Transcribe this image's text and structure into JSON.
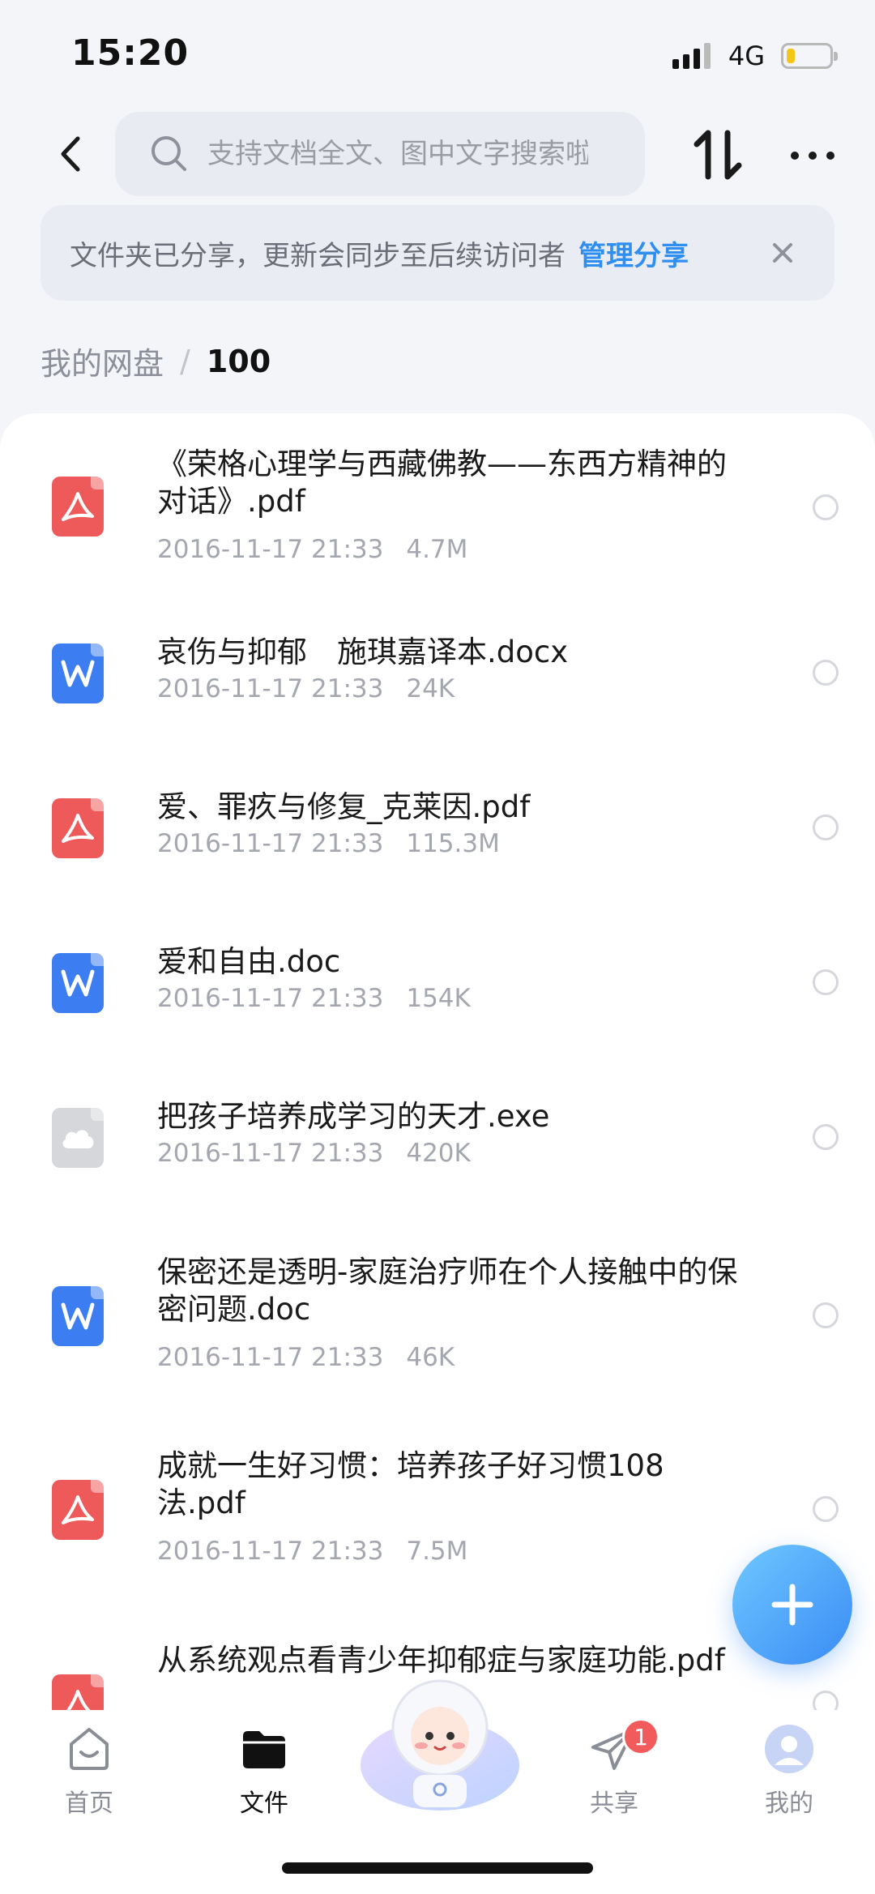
{
  "status_bar": {
    "time": "15:20",
    "network": "4G",
    "battery_level": 0.2
  },
  "search": {
    "placeholder": "支持文档全文、图中文字搜索啦"
  },
  "share_banner": {
    "text": "文件夹已分享，更新会同步至后续访问者",
    "link": "管理分享"
  },
  "breadcrumb": {
    "root": "我的网盘",
    "separator": "/",
    "current": "100"
  },
  "files": [
    {
      "name": "《荣格心理学与西藏佛教——东西方精神的对话》.pdf",
      "date": "2016-11-17 21:33",
      "size": "4.7M",
      "type": "pdf"
    },
    {
      "name": "哀伤与抑郁　施琪嘉译本.docx",
      "date": "2016-11-17 21:33",
      "size": "24K",
      "type": "word"
    },
    {
      "name": "爱、罪疚与修复_克莱因.pdf",
      "date": "2016-11-17 21:33",
      "size": "115.3M",
      "type": "pdf"
    },
    {
      "name": "爱和自由.doc",
      "date": "2016-11-17 21:33",
      "size": "154K",
      "type": "word"
    },
    {
      "name": "把孩子培养成学习的天才.exe",
      "date": "2016-11-17 21:33",
      "size": "420K",
      "type": "other"
    },
    {
      "name": "保密还是透明-家庭治疗师在个人接触中的保密问题.doc",
      "date": "2016-11-17 21:33",
      "size": "46K",
      "type": "word"
    },
    {
      "name": "成就一生好习惯：培养孩子好习惯108法.pdf",
      "date": "2016-11-17 21:33",
      "size": "7.5M",
      "type": "pdf"
    },
    {
      "name": "从系统观点看青少年抑郁症与家庭功能.pdf",
      "date": "",
      "size": "",
      "type": "pdf"
    }
  ],
  "tabs": [
    {
      "label": "首页",
      "icon": "home-icon"
    },
    {
      "label": "文件",
      "icon": "folder-icon"
    },
    {
      "label": "共享",
      "icon": "share-plane-icon",
      "badge": "1"
    },
    {
      "label": "我的",
      "icon": "profile-icon"
    }
  ],
  "colors": {
    "accent": "#2f8ff1",
    "pdf": "#ee5a5a",
    "word": "#3d7df2",
    "badge": "#f15b5b"
  }
}
